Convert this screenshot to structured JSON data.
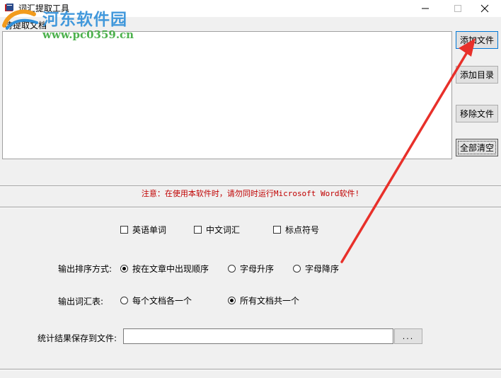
{
  "window": {
    "title": "词汇提取工具",
    "icon": "app-book-icon",
    "controls": [
      "minimize-icon",
      "maximize-icon",
      "close-icon"
    ]
  },
  "watermark": {
    "site_name": "河东软件园",
    "url": "www.pc0359.cn"
  },
  "files": {
    "label": "待提取文档",
    "items": []
  },
  "buttons": {
    "add_file": "添加文件",
    "add_dir": "添加目录",
    "remove_file": "移除文件",
    "clear_all": "全部清空"
  },
  "notice": "注意：在使用本软件时，请勿同时运行Microsoft Word软件!",
  "extract_options": [
    {
      "label": "英语单词",
      "checked": false
    },
    {
      "label": "中文词汇",
      "checked": false
    },
    {
      "label": "标点符号",
      "checked": false
    }
  ],
  "sort": {
    "label": "输出排序方式:",
    "options": [
      {
        "label": "按在文章中出现顺序",
        "selected": true
      },
      {
        "label": "字母升序",
        "selected": false
      },
      {
        "label": "字母降序",
        "selected": false
      }
    ]
  },
  "output": {
    "label": "输出词汇表:",
    "options": [
      {
        "label": "每个文档各一个",
        "selected": false
      },
      {
        "label": "所有文档共一个",
        "selected": true
      }
    ]
  },
  "save": {
    "label": "统计结果保存到文件:",
    "value": "",
    "browse_label": "..."
  },
  "colors": {
    "notice_text": "#c00000",
    "annotation_arrow": "#e8302a",
    "focus_border": "#0078d7"
  }
}
